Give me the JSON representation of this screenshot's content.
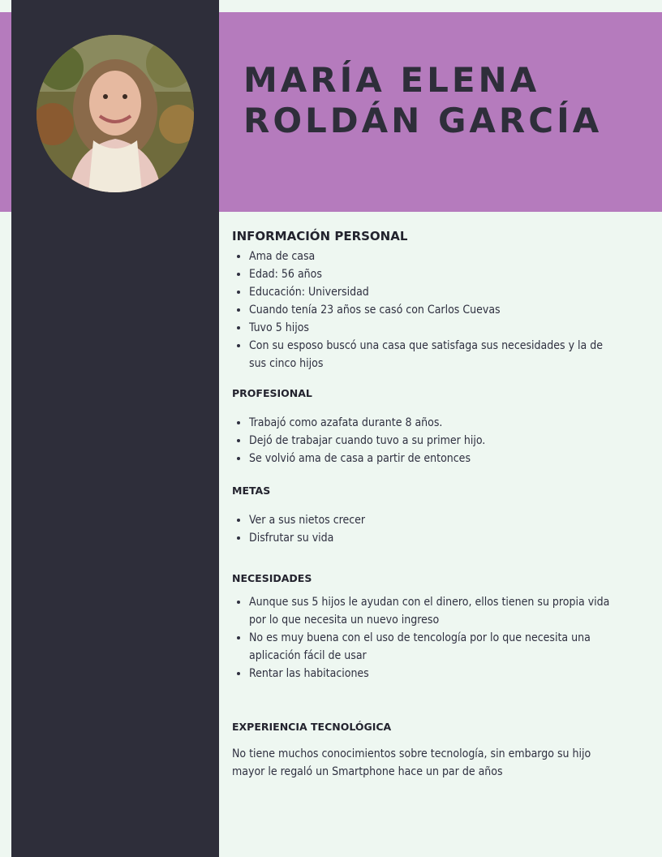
{
  "header": {
    "name_line1": "MARÍA ELENA",
    "name_line2": "ROLDÁN GARCÍA",
    "photo_alt": "Foto de perfil"
  },
  "sections": {
    "personal": {
      "title": "INFORMACIÓN PERSONAL",
      "items": [
        "Ama de casa",
        "Edad: 56 años",
        "Educación: Universidad",
        "Cuando tenía 23 años se casó con Carlos Cuevas",
        "Tuvo 5 hijos",
        "Con su esposo buscó una casa que satisfaga sus  necesidades y la de sus cinco hijos"
      ]
    },
    "profesional": {
      "title": "PROFESIONAL",
      "items": [
        "Trabajó como azafata durante 8 años.",
        "Dejó de trabajar cuando tuvo a su primer hijo.",
        "Se volvió ama de casa a partir de entonces"
      ]
    },
    "metas": {
      "title": "METAS",
      "items": [
        "Ver a sus nietos crecer",
        "Disfrutar su vida"
      ]
    },
    "necesidades": {
      "title": "NECESIDADES",
      "items": [
        "Aunque sus 5 hijos le ayudan con el dinero, ellos tienen su propia vida por lo que necesita un nuevo ingreso",
        "No es muy buena con el uso de tencología por lo que necesita una aplicación fácil de usar",
        "Rentar las habitaciones"
      ]
    },
    "experiencia": {
      "title": "EXPERIENCIA TECNOLÓGICA",
      "text": "No tiene muchos conocimientos sobre tecnología, sin embargo su hijo mayor le regaló un Smartphone hace un par de años"
    }
  },
  "colors": {
    "sidebar": "#2e2e3a",
    "banner": "#b57bbd",
    "background": "#eef7f1",
    "text": "#2f3040"
  }
}
